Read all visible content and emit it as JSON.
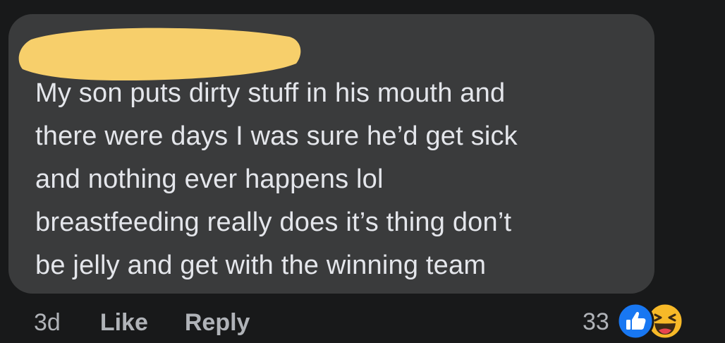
{
  "comment": {
    "author_redacted": true,
    "text_lines": [
      "My son puts dirty stuff in his mouth and",
      "there were days I was sure he’d get sick",
      "and nothing ever happens lol",
      "breastfeeding really does it’s thing don’t",
      "be jelly and get with the winning team"
    ]
  },
  "actions": {
    "timestamp": "3d",
    "like_label": "Like",
    "reply_label": "Reply"
  },
  "reactions": {
    "count": "33",
    "icons": [
      "like-reaction-icon",
      "haha-reaction-icon"
    ]
  },
  "colors": {
    "background": "#18191a",
    "bubble": "#3a3b3c",
    "text": "#e4e6eb",
    "secondary_text": "#b0b3b8",
    "redaction": "#f7cf6b",
    "like_blue": "#1877f2",
    "haha_yellow": "#f7b928"
  }
}
